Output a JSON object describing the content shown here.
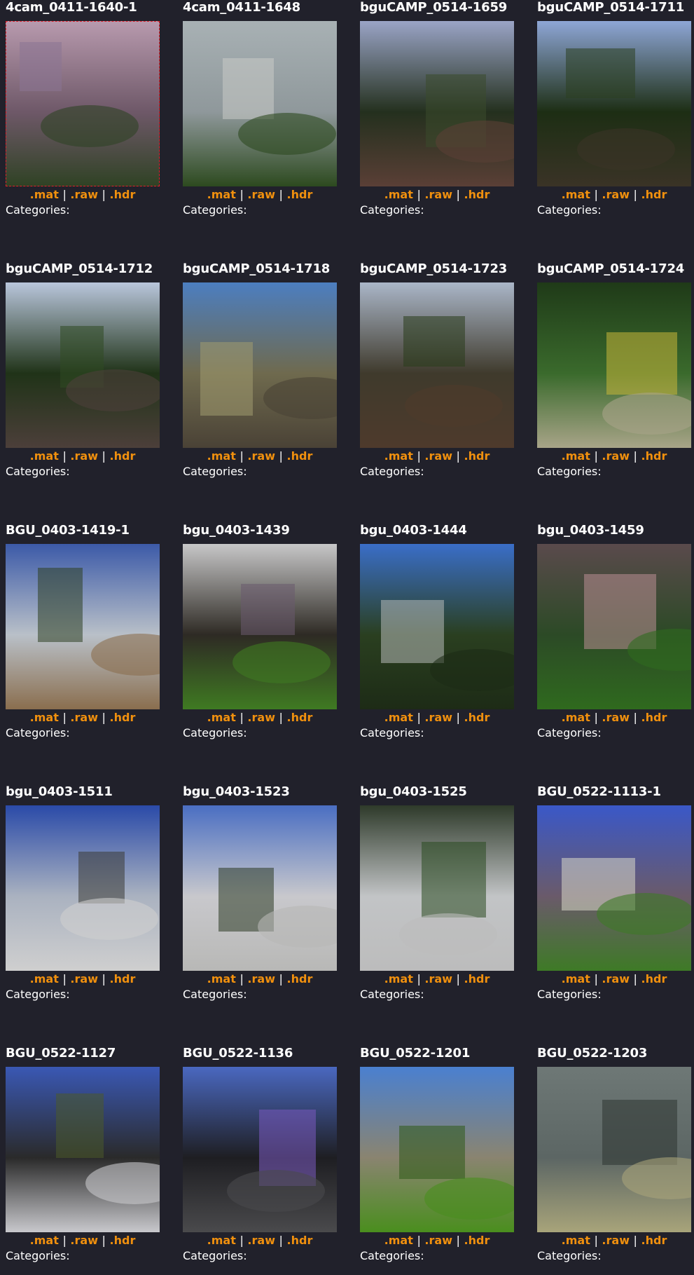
{
  "link_labels": {
    "mat": ".mat",
    "raw": ".raw",
    "hdr": ".hdr",
    "sep": "|"
  },
  "categories_label": "Categories:",
  "items": [
    {
      "title": "4cam_0411-1640-1",
      "palette": {
        "sky": "#b89aae",
        "mid": "#6e5868",
        "ground": "#2f4224",
        "accent": "#8a7494"
      },
      "selected": true
    },
    {
      "title": "4cam_0411-1648",
      "palette": {
        "sky": "#a8b1b4",
        "mid": "#8f989b",
        "ground": "#2d4a1f",
        "accent": "#c9cbc6"
      },
      "selected": false
    },
    {
      "title": "bguCAMP_0514-1659",
      "palette": {
        "sky": "#9aa4c6",
        "mid": "#24301e",
        "ground": "#5a3f36",
        "accent": "#3b4a2c"
      },
      "selected": false
    },
    {
      "title": "bguCAMP_0514-1711",
      "palette": {
        "sky": "#8ea6d6",
        "mid": "#1d2e14",
        "ground": "#3a3326",
        "accent": "#2b4020"
      },
      "selected": false
    },
    {
      "title": "bguCAMP_0514-1712",
      "palette": {
        "sky": "#b9c6dc",
        "mid": "#203318",
        "ground": "#4c3f3a",
        "accent": "#2f4a22"
      },
      "selected": false
    },
    {
      "title": "bguCAMP_0514-1718",
      "palette": {
        "sky": "#4c7ec0",
        "mid": "#6f6a4e",
        "ground": "#4a4236",
        "accent": "#a09a70"
      },
      "selected": false
    },
    {
      "title": "bguCAMP_0514-1723",
      "palette": {
        "sky": "#aab6c8",
        "mid": "#3f3a2c",
        "ground": "#4e3a2c",
        "accent": "#2a3c1c"
      },
      "selected": false
    },
    {
      "title": "bguCAMP_0514-1724",
      "palette": {
        "sky": "#1f3a18",
        "mid": "#3a6a2c",
        "ground": "#a8a488",
        "accent": "#c9b63a"
      },
      "selected": false
    },
    {
      "title": "BGU_0403-1419-1",
      "palette": {
        "sky": "#3c5aa8",
        "mid": "#b9c0c8",
        "ground": "#8a6e4e",
        "accent": "#2e3f22"
      },
      "selected": false
    },
    {
      "title": "bgu_0403-1439",
      "palette": {
        "sky": "#c7c7c8",
        "mid": "#2e2a24",
        "ground": "#3f7a22",
        "accent": "#6a5a6e"
      },
      "selected": false
    },
    {
      "title": "bgu_0403-1444",
      "palette": {
        "sky": "#3a6ec8",
        "mid": "#2a3f20",
        "ground": "#1d2b16",
        "accent": "#b6bab8"
      },
      "selected": false
    },
    {
      "title": "bgu_0403-1459",
      "palette": {
        "sky": "#5a4a4c",
        "mid": "#2c4a26",
        "ground": "#2f6a1e",
        "accent": "#b98e94"
      },
      "selected": false
    },
    {
      "title": "bgu_0403-1511",
      "palette": {
        "sky": "#2a4aa8",
        "mid": "#aab2c0",
        "ground": "#cfcfcf",
        "accent": "#3a3a34"
      },
      "selected": false
    },
    {
      "title": "bgu_0403-1523",
      "palette": {
        "sky": "#4a6ec2",
        "mid": "#c8c8cc",
        "ground": "#b8b8b6",
        "accent": "#2c3a24"
      },
      "selected": false
    },
    {
      "title": "bgu_0403-1525",
      "palette": {
        "sky": "#2e3a2a",
        "mid": "#c2c4c6",
        "ground": "#bcbcbc",
        "accent": "#2a4a20"
      },
      "selected": false
    },
    {
      "title": "BGU_0522-1113-1",
      "palette": {
        "sky": "#3a58c8",
        "mid": "#6a5a6a",
        "ground": "#3e7a26",
        "accent": "#d8d8c8"
      },
      "selected": false
    },
    {
      "title": "BGU_0522-1127",
      "palette": {
        "sky": "#3a58b4",
        "mid": "#2a2a2a",
        "ground": "#c8c8cc",
        "accent": "#4a5a2a"
      },
      "selected": false
    },
    {
      "title": "BGU_0522-1136",
      "palette": {
        "sky": "#4a68c0",
        "mid": "#1e1e22",
        "ground": "#4a4a4c",
        "accent": "#7a5ac0"
      },
      "selected": false
    },
    {
      "title": "BGU_0522-1201",
      "palette": {
        "sky": "#4a80d0",
        "mid": "#8a8470",
        "ground": "#4a8e1e",
        "accent": "#2e5a18"
      },
      "selected": false
    },
    {
      "title": "BGU_0522-1203",
      "palette": {
        "sky": "#6e7876",
        "mid": "#5c6664",
        "ground": "#a8a47a",
        "accent": "#2e3432"
      },
      "selected": false
    }
  ]
}
